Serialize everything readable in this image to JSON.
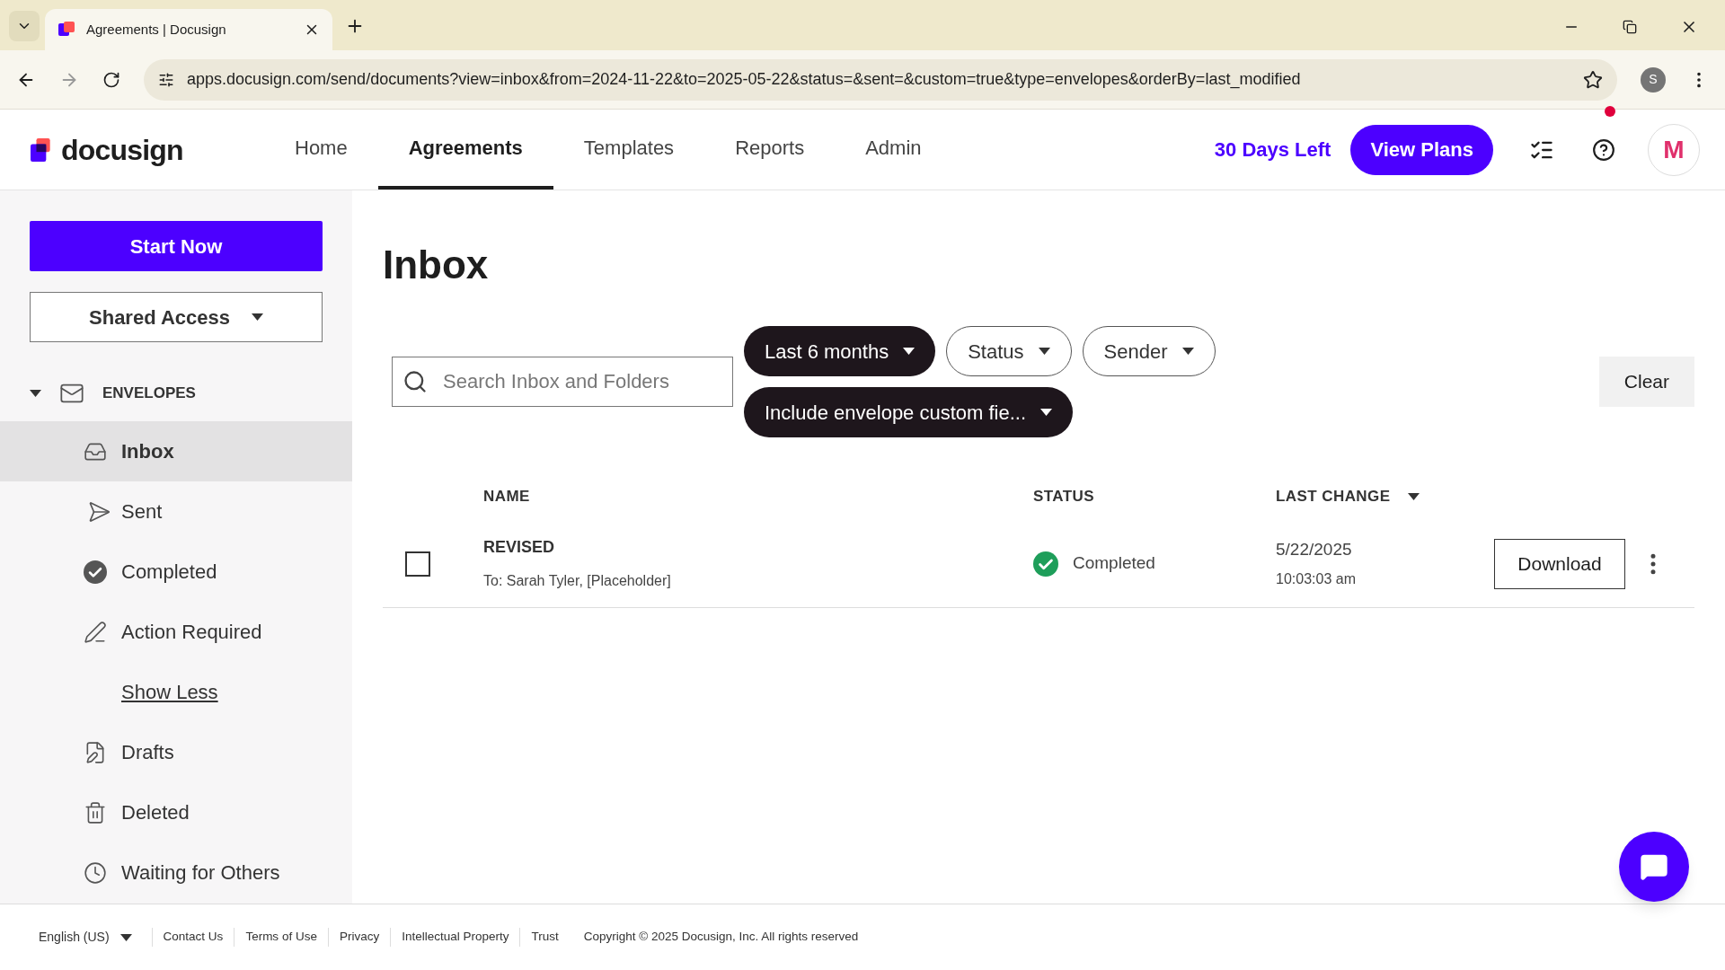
{
  "browser": {
    "tab_title": "Agreements | Docusign",
    "url": "apps.docusign.com/send/documents?view=inbox&from=2024-11-22&to=2025-05-22&status=&sent=&custom=true&type=envelopes&orderBy=last_modified",
    "profile_initial": "S"
  },
  "header": {
    "logo": "docusign",
    "nav": [
      {
        "label": "Home",
        "selected": false
      },
      {
        "label": "Agreements",
        "selected": true
      },
      {
        "label": "Templates",
        "selected": false
      },
      {
        "label": "Reports",
        "selected": false
      },
      {
        "label": "Admin",
        "selected": false
      }
    ],
    "trial": "30 Days Left",
    "cta": "View Plans",
    "has_notification": true,
    "avatar_initial": "M"
  },
  "sidebar": {
    "start_button": "Start Now",
    "shared_access": "Shared Access",
    "section": {
      "label": "ENVELOPES",
      "expanded": true
    },
    "items": [
      {
        "label": "Inbox",
        "kind": "folder",
        "selected": true
      },
      {
        "label": "Sent",
        "kind": "folder",
        "selected": false
      },
      {
        "label": "Completed",
        "kind": "folder",
        "selected": false
      },
      {
        "label": "Action Required",
        "kind": "folder",
        "selected": false
      },
      {
        "label": "Show Less",
        "kind": "link",
        "selected": false
      },
      {
        "label": "Drafts",
        "kind": "folder",
        "selected": false
      },
      {
        "label": "Deleted",
        "kind": "folder",
        "selected": false
      },
      {
        "label": "Waiting for Others",
        "kind": "folder",
        "selected": false
      }
    ]
  },
  "page": {
    "title": "Inbox",
    "search": {
      "placeholder": "Search Inbox and Folders"
    },
    "filters": [
      {
        "label": "Last 6 months",
        "active": true
      },
      {
        "label": "Status",
        "active": false
      },
      {
        "label": "Sender",
        "active": false
      },
      {
        "label": "Include envelope custom fie...",
        "active": true
      }
    ],
    "clear": "Clear",
    "table": {
      "columns": [
        {
          "label": "NAME",
          "sorted": false
        },
        {
          "label": "STATUS",
          "sorted": false
        },
        {
          "label": "LAST CHANGE",
          "sorted": true
        }
      ],
      "rows": [
        {
          "name": "REVISED",
          "recipients": "To: Sarah Tyler, [Placeholder]",
          "checked": false,
          "status": {
            "label": "Completed",
            "kind": "completed"
          },
          "date": "5/22/2025",
          "time": "10:03:03 am",
          "action": "Download"
        }
      ]
    }
  },
  "footer": {
    "language": "English (US)",
    "links": [
      "Contact Us",
      "Terms of Use",
      "Privacy",
      "Intellectual Property",
      "Trust"
    ],
    "copyright": "Copyright © 2025 Docusign, Inc. All rights reserved"
  }
}
